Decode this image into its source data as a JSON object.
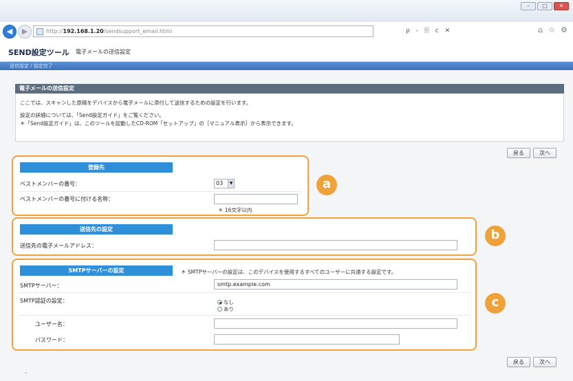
{
  "browser": {
    "url_scheme": "http://",
    "url_host": "192.168.1.20",
    "url_path": "/sendsupport_email.html",
    "address_controls": "ρ - 🗏 c ✕",
    "window_controls": [
      "–",
      "□",
      "✕"
    ],
    "toolbar_icons": [
      "home-icon",
      "star-icon",
      "gear-icon"
    ]
  },
  "app": {
    "title": "SEND設定ツール",
    "subtitle": "電子メールの送信設定"
  },
  "breadcrumb": "送信設定 / 設定完了",
  "section": {
    "title": "電子メールの送信設定",
    "intro": [
      "ここでは、スキャンした原稿をデバイスから電子メールに添付して送信するための設定を行います。",
      "設定の詳細については、「Send設定ガイド」をご覧ください。",
      "＊「Send設定ガイド」は、このツールを起動したCD-ROM「セットアップ」の［マニュアル表示］から表示できます。"
    ]
  },
  "buttons": {
    "back": "戻る",
    "next": "次へ"
  },
  "group_a": {
    "title": "登録先",
    "member_number_label": "ベストメンバーの番号：",
    "member_number_value": "03",
    "member_name_label": "ベストメンバーの番号に付ける名称：",
    "member_name_value": "",
    "member_name_hint": "＊ 16文字以内"
  },
  "group_b": {
    "title": "送信先の設定",
    "email_label": "送信先の電子メールアドレス：",
    "email_value": ""
  },
  "group_c": {
    "title": "SMTPサーバーの設定",
    "note": "＊ SMTPサーバーの設定は、このデバイスを使用するすべてのユーザーに共通する設定です。",
    "server_label": "SMTPサーバー：",
    "server_value": "smtp.example.com",
    "auth_label": "SMTP認証の設定：",
    "auth_options": [
      "なし",
      "あり"
    ],
    "auth_selected": "なし",
    "user_label": "ユーザー名：",
    "user_value": "",
    "password_label": "パスワード：",
    "password_value": ""
  },
  "markers": [
    "a",
    "b",
    "c"
  ],
  "colors": {
    "accent_orange": "#f0a23a",
    "header_blue": "#2f8fd8",
    "breadcrumb_blue": "#3c72be",
    "section_gray": "#5d6d80"
  }
}
